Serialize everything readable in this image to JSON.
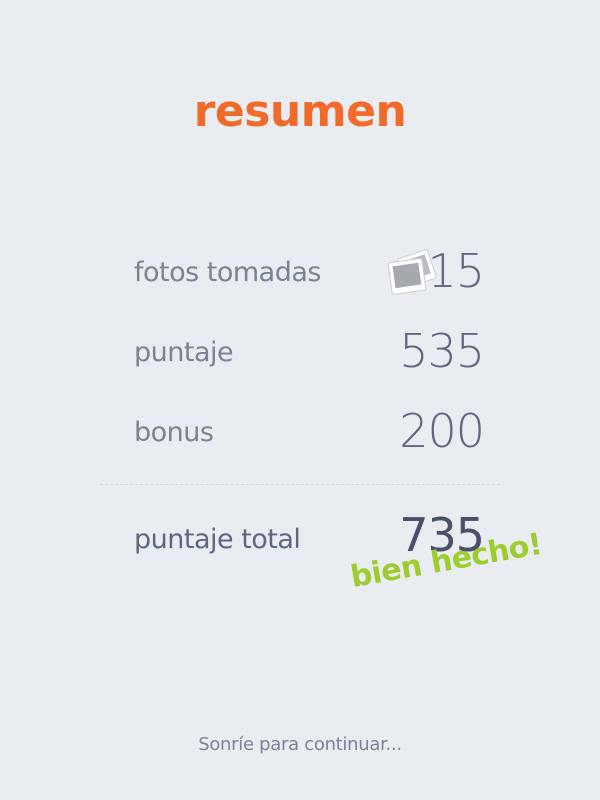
{
  "header": {
    "title": "resumen"
  },
  "summary": {
    "photos": {
      "label": "fotos tomadas",
      "value": "15",
      "icon": "photo-stack-icon"
    },
    "score": {
      "label": "puntaje",
      "value": "535"
    },
    "bonus": {
      "label": "bonus",
      "value": "200"
    },
    "total": {
      "label": "puntaje total",
      "value": "735"
    }
  },
  "badge": {
    "text": "bien hecho!"
  },
  "footer": {
    "prompt": "Sonríe para continuar..."
  },
  "colors": {
    "background": "#e9edf1",
    "accent": "#f06a2a",
    "badge": "#9ccd2f",
    "text": "#7b8296",
    "value": "#5f6680"
  }
}
